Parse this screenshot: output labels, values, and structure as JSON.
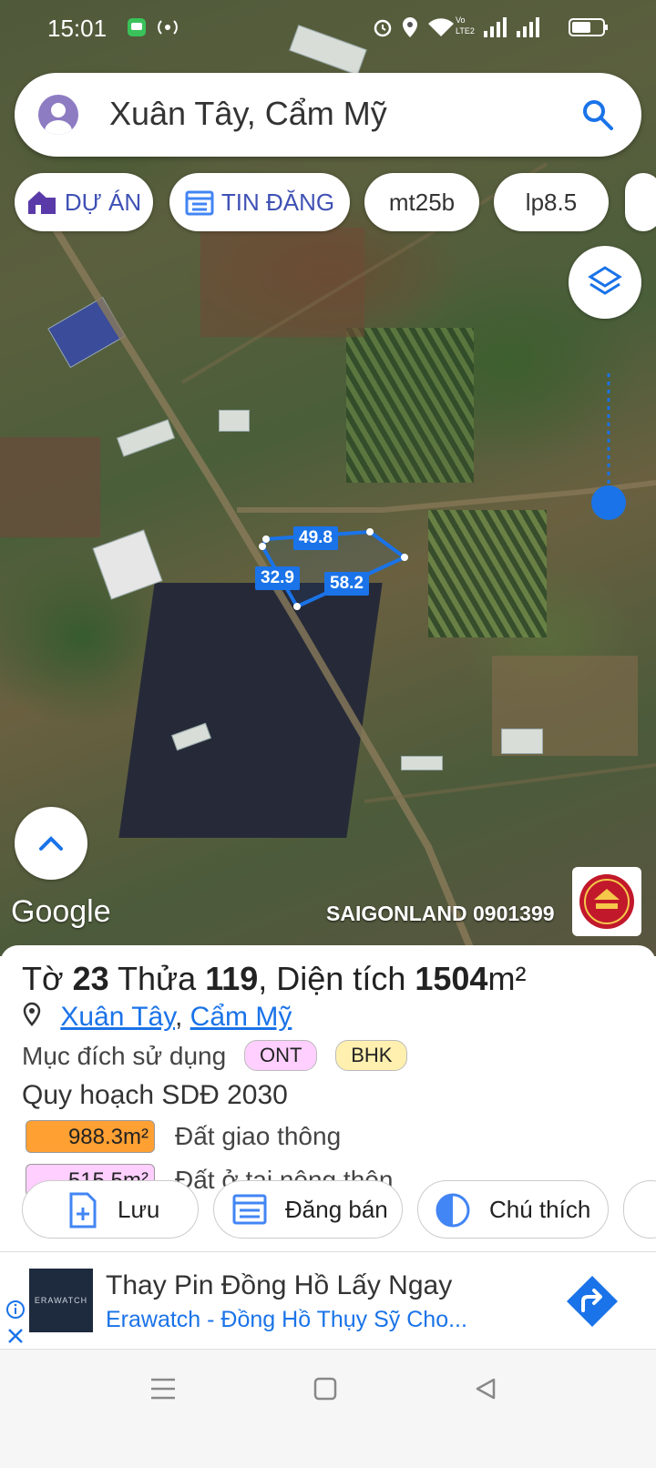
{
  "status_bar": {
    "time": "15:01",
    "icons": [
      "message-icon",
      "hotspot-icon",
      "alarm-icon",
      "location-icon",
      "wifi-icon",
      "volte-icon",
      "signal-icon",
      "signal-icon",
      "battery-icon"
    ],
    "volte_label": "Vo LTE2"
  },
  "search": {
    "text": "Xuân Tây, Cẩm Mỹ"
  },
  "chips": [
    {
      "label": "DỰ ÁN",
      "icon": "house-icon"
    },
    {
      "label": "TIN ĐĂNG",
      "icon": "calendar-list-icon"
    },
    {
      "label": "mt25b"
    },
    {
      "label": "lp8.5"
    }
  ],
  "map": {
    "plot_dimensions": [
      "49.8",
      "32.9",
      "58.2"
    ],
    "google": "Google",
    "watermark": "SAIGONLAND 0901399",
    "logo_text": "SÀI GÒN LAND",
    "colors": {
      "plot_outline": "#1a73e8",
      "dim_label_bg": "#1a73e8",
      "slider": "#1a73e8"
    }
  },
  "parcel": {
    "sheet_label": "Tờ",
    "sheet": "23",
    "lot_label": "Thửa",
    "lot": "119",
    "area_label": ", Diện tích",
    "area": "1504",
    "area_unit": "m²",
    "location_1": "Xuân Tây",
    "location_sep": ",",
    "location_2": "Cẩm Mỹ",
    "usage_label": "Mục đích sử dụng",
    "usage_badges": [
      {
        "code": "ONT",
        "color": "#ffd0ff"
      },
      {
        "code": "BHK",
        "color": "#fff0b0"
      }
    ],
    "plan_title": "Quy hoạch SDĐ 2030",
    "zones": [
      {
        "value": "988.3m²",
        "label": "Đất giao thông",
        "color": "#ffa033"
      },
      {
        "value": "515.5m²",
        "label": "Đất ở tại nông thôn",
        "color": "#ffcfff"
      }
    ]
  },
  "actions": [
    {
      "label": "Lưu",
      "icon": "file-add-icon"
    },
    {
      "label": "Đăng bán",
      "icon": "calendar-list-icon"
    },
    {
      "label": "Chú thích",
      "icon": "half-circle-icon"
    }
  ],
  "ad": {
    "brand_logo": "ERAWATCH",
    "title": "Thay Pin Đồng Hồ Lấy Ngay",
    "subtitle": "Erawatch - Đồng Hồ Thụy Sỹ Cho..."
  }
}
